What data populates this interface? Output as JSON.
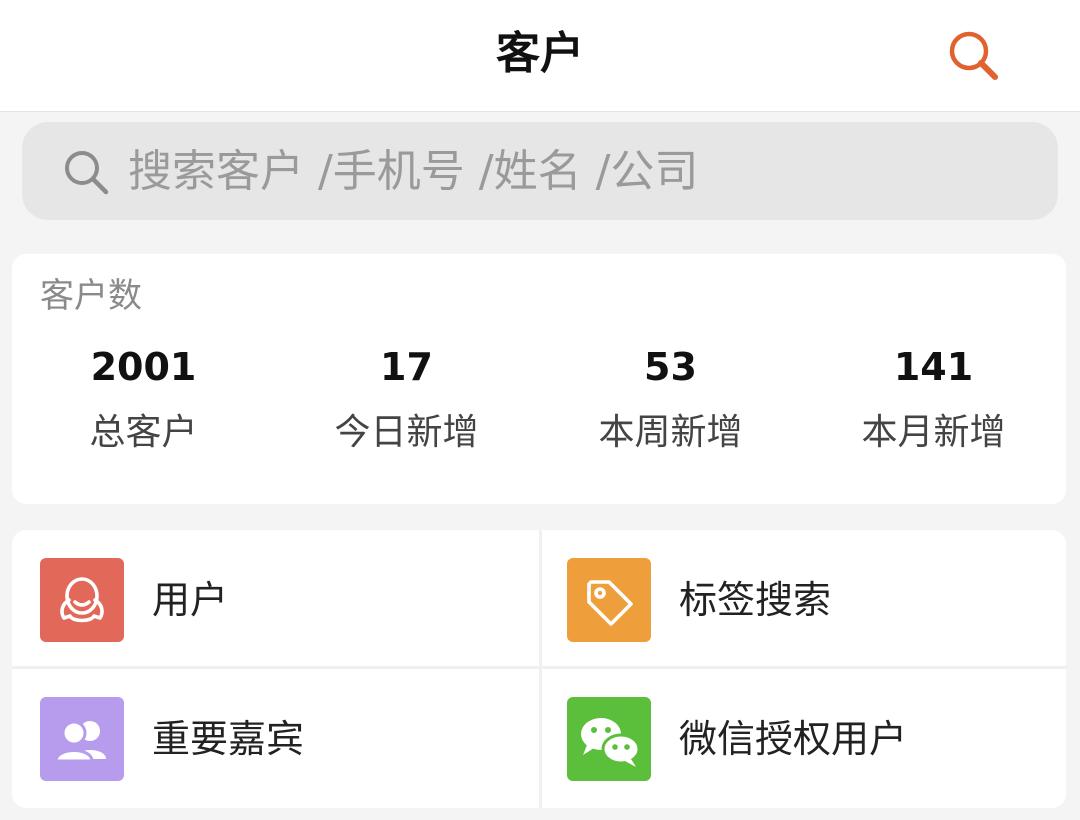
{
  "header": {
    "title": "客户",
    "search_icon": "search-icon",
    "accent_color": "#e0622f"
  },
  "search": {
    "placeholder": "搜索客户 /手机号 /姓名 /公司",
    "icon": "search-icon"
  },
  "stats": {
    "title": "客户数",
    "items": [
      {
        "value": "2001",
        "label": "总客户"
      },
      {
        "value": "17",
        "label": "今日新增"
      },
      {
        "value": "53",
        "label": "本周新增"
      },
      {
        "value": "141",
        "label": "本月新增"
      }
    ]
  },
  "menu": {
    "items": [
      {
        "label": "用户",
        "icon": "user-icon",
        "color": "#e2685a"
      },
      {
        "label": "标签搜索",
        "icon": "tag-icon",
        "color": "#ee9e3a"
      },
      {
        "label": "重要嘉宾",
        "icon": "group-icon",
        "color": "#b79cee"
      },
      {
        "label": "微信授权用户",
        "icon": "wechat-icon",
        "color": "#5cbf3b"
      }
    ]
  }
}
